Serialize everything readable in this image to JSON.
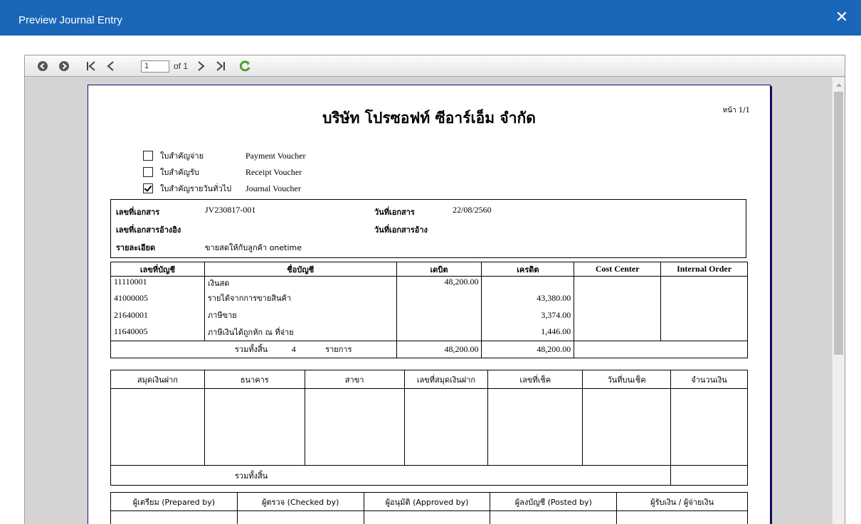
{
  "window": {
    "title": "Preview Journal Entry"
  },
  "toolbar": {
    "current_page": "1",
    "of_text": "of 1"
  },
  "report": {
    "company": "บริษัท โปรซอฟท์ ซีอาร์เอ็ม จำกัด",
    "page_no": "หน้า 1/1",
    "voucher_types": [
      {
        "th": "ใบสำคัญจ่าย",
        "en": "Payment Voucher",
        "checked": false
      },
      {
        "th": "ใบสำคัญรับ",
        "en": "Receipt Voucher",
        "checked": false
      },
      {
        "th": "ใบสำคัญรายวันทั่วไป",
        "en": "Journal Voucher",
        "checked": true
      }
    ],
    "doc": {
      "doc_no_label": "เลขที่เอกสาร",
      "doc_no": "JV230817-001",
      "doc_date_label": "วันที่เอกสาร",
      "doc_date": "22/08/2560",
      "ref_no_label": "เลขที่เอกสารอ้างอิง",
      "ref_date_label": "วันที่เอกสารอ้าง",
      "detail_label": "รายละเอียด",
      "detail": "ขายสดให้กับลูกค้า onetime"
    },
    "accounts": {
      "headers": [
        "เลขที่บัญชี",
        "ชื่อบัญชี",
        "เดบิต",
        "เครดิต",
        "Cost Center",
        "Internal Order"
      ],
      "rows": [
        {
          "code": "11110001",
          "name": "เงินสด",
          "debit": "48,200.00",
          "credit": ""
        },
        {
          "code": "41000005",
          "name": "รายได้จากการขายสินค้า",
          "debit": "",
          "credit": "43,380.00"
        },
        {
          "code": "21640001",
          "name": "ภาษีขาย",
          "debit": "",
          "credit": "3,374.00"
        },
        {
          "code": "11640005",
          "name": "ภาษีเงินได้ถูกหัก ณ ที่จ่าย",
          "debit": "",
          "credit": "1,446.00"
        }
      ],
      "total_label": "รวมทั้งสิ้น",
      "total_count": "4",
      "total_unit": "รายการ",
      "total_debit": "48,200.00",
      "total_credit": "48,200.00"
    },
    "bank": {
      "headers": [
        "สมุดเงินฝาก",
        "ธนาคาร",
        "สาขา",
        "เลขที่สมุดเงินฝาก",
        "เลขที่เช็ค",
        "วันที่บนเช็ค",
        "จำนวนเงิน"
      ],
      "total_label": "รวมทั้งสิ้น"
    },
    "signatures": {
      "headers": [
        "ผู้เตรียม (Prepared by)",
        "ผู้ตรวจ (Checked by)",
        "ผู้อนุมัติ (Approved by)",
        "ผู้ลงบัญชี (Posted by)",
        "ผู้รับเงิน / ผู้จ่ายเงิน"
      ]
    }
  },
  "icons": [
    "circle-left-icon",
    "circle-right-icon",
    "first-page-icon",
    "prev-page-icon",
    "next-page-icon",
    "last-page-icon",
    "refresh-icon",
    "close-icon"
  ],
  "colors": {
    "titlebar": "#1a66b8",
    "refresh": "#4aa02c"
  }
}
